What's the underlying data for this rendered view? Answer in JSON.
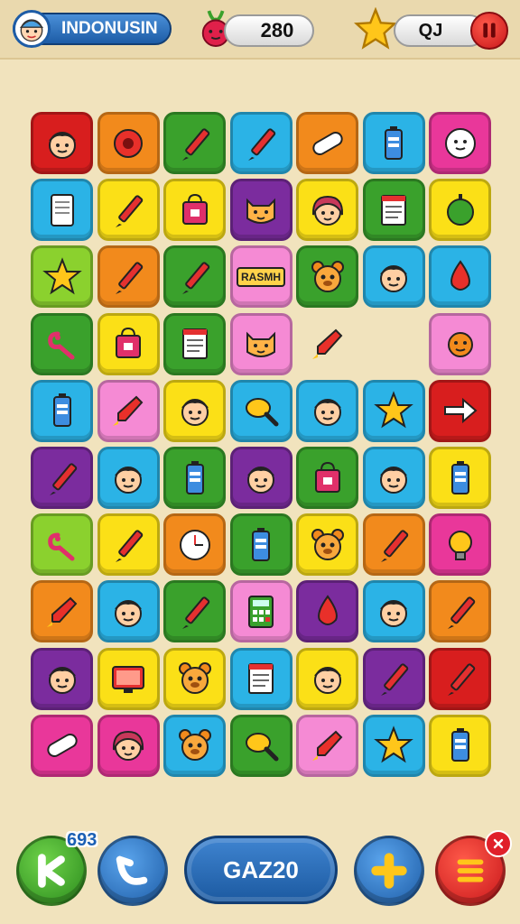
{
  "header": {
    "player_name": "INDONUSIN",
    "score": "280",
    "stars": "QJ"
  },
  "footer": {
    "hint_count": "693",
    "level_label": "GAZ20"
  },
  "colors": {
    "red": "#d81e1e",
    "orange": "#f28a1c",
    "green": "#3aa12c",
    "blue": "#2bb3e6",
    "pink": "#e9379a",
    "yellow": "#fbe017",
    "purple": "#7b2c9e",
    "lime": "#8bd12e",
    "lightpink": "#f58ad4"
  },
  "board": {
    "rows": [
      [
        {
          "bg": "red",
          "icon": "face-boy"
        },
        {
          "bg": "orange",
          "icon": "flower"
        },
        {
          "bg": "green",
          "icon": "pen"
        },
        {
          "bg": "blue",
          "icon": "pen"
        },
        {
          "bg": "orange",
          "icon": "bandage"
        },
        {
          "bg": "blue",
          "icon": "battery"
        },
        {
          "bg": "pink",
          "icon": "face-ghost"
        }
      ],
      [
        {
          "bg": "blue",
          "icon": "tablet"
        },
        {
          "bg": "yellow",
          "icon": "pen"
        },
        {
          "bg": "yellow",
          "icon": "bag"
        },
        {
          "bg": "purple",
          "icon": "face-cat"
        },
        {
          "bg": "yellow",
          "icon": "face-girl"
        },
        {
          "bg": "green",
          "icon": "document"
        },
        {
          "bg": "yellow",
          "icon": "ball"
        }
      ],
      [
        {
          "bg": "lime",
          "icon": "star"
        },
        {
          "bg": "orange",
          "icon": "pen"
        },
        {
          "bg": "green",
          "icon": "pen"
        },
        {
          "bg": "lightpink",
          "icon": "text",
          "text": "RASMH"
        },
        {
          "bg": "green",
          "icon": "face-bear"
        },
        {
          "bg": "blue",
          "icon": "face-boy"
        },
        {
          "bg": "blue",
          "icon": "drop"
        }
      ],
      [
        {
          "bg": "green",
          "icon": "hook"
        },
        {
          "bg": "yellow",
          "icon": "bag"
        },
        {
          "bg": "green",
          "icon": "document"
        },
        {
          "bg": "lightpink",
          "icon": "face-cat"
        },
        {
          "bg": "none",
          "icon": "rocket"
        },
        {
          "bg": "none",
          "icon": "empty"
        },
        {
          "bg": "lightpink",
          "icon": "sun"
        }
      ],
      [
        {
          "bg": "blue",
          "icon": "battery"
        },
        {
          "bg": "lightpink",
          "icon": "rocket"
        },
        {
          "bg": "yellow",
          "icon": "face-boy"
        },
        {
          "bg": "blue",
          "icon": "racket"
        },
        {
          "bg": "blue",
          "icon": "face-boy"
        },
        {
          "bg": "blue",
          "icon": "star"
        },
        {
          "bg": "red",
          "icon": "arrow"
        }
      ],
      [
        {
          "bg": "purple",
          "icon": "pen"
        },
        {
          "bg": "blue",
          "icon": "face-boy"
        },
        {
          "bg": "green",
          "icon": "battery"
        },
        {
          "bg": "purple",
          "icon": "face-boy"
        },
        {
          "bg": "green",
          "icon": "bag"
        },
        {
          "bg": "blue",
          "icon": "face-boy"
        },
        {
          "bg": "yellow",
          "icon": "battery"
        }
      ],
      [
        {
          "bg": "lime",
          "icon": "hook"
        },
        {
          "bg": "yellow",
          "icon": "pen"
        },
        {
          "bg": "orange",
          "icon": "clock"
        },
        {
          "bg": "green",
          "icon": "battery"
        },
        {
          "bg": "yellow",
          "icon": "face-bear"
        },
        {
          "bg": "orange",
          "icon": "pen"
        },
        {
          "bg": "pink",
          "icon": "bulb"
        }
      ],
      [
        {
          "bg": "orange",
          "icon": "rocket"
        },
        {
          "bg": "blue",
          "icon": "face-boy"
        },
        {
          "bg": "green",
          "icon": "pen"
        },
        {
          "bg": "lightpink",
          "icon": "calculator"
        },
        {
          "bg": "purple",
          "icon": "drop"
        },
        {
          "bg": "blue",
          "icon": "face-boy"
        },
        {
          "bg": "orange",
          "icon": "pen"
        }
      ],
      [
        {
          "bg": "purple",
          "icon": "face-boy"
        },
        {
          "bg": "yellow",
          "icon": "tv"
        },
        {
          "bg": "yellow",
          "icon": "face-bear"
        },
        {
          "bg": "blue",
          "icon": "document"
        },
        {
          "bg": "yellow",
          "icon": "face-boy"
        },
        {
          "bg": "purple",
          "icon": "pen"
        },
        {
          "bg": "red",
          "icon": "pen"
        }
      ],
      [
        {
          "bg": "pink",
          "icon": "bandage"
        },
        {
          "bg": "pink",
          "icon": "face-girl"
        },
        {
          "bg": "blue",
          "icon": "face-bear"
        },
        {
          "bg": "green",
          "icon": "racket"
        },
        {
          "bg": "lightpink",
          "icon": "rocket"
        },
        {
          "bg": "blue",
          "icon": "star"
        },
        {
          "bg": "yellow",
          "icon": "battery"
        }
      ]
    ]
  }
}
